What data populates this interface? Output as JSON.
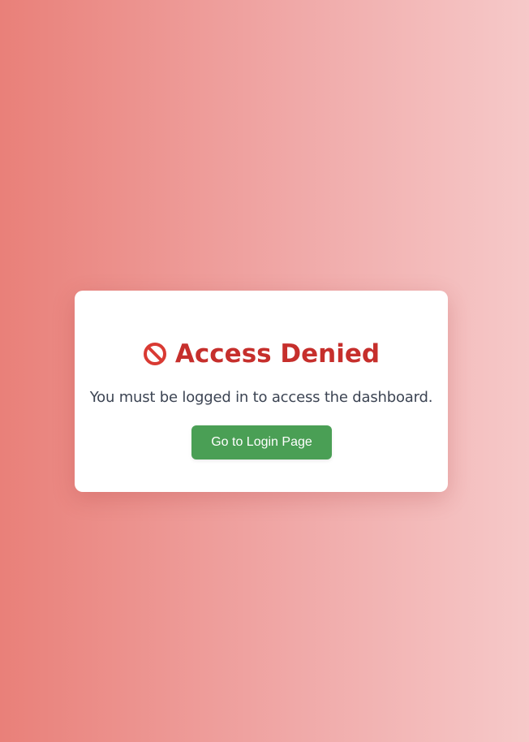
{
  "card": {
    "title": "Access Denied",
    "title_icon": "prohibited-icon",
    "message": "You must be logged in to access the dashboard.",
    "login_button_label": "Go to Login Page"
  },
  "colors": {
    "background_gradient_start": "#e98079",
    "background_gradient_end": "#f6c9c9",
    "title": "#c62f2c",
    "message": "#3c4453",
    "button": "#4a9f55",
    "button_text": "#ffffff",
    "card": "#ffffff"
  }
}
